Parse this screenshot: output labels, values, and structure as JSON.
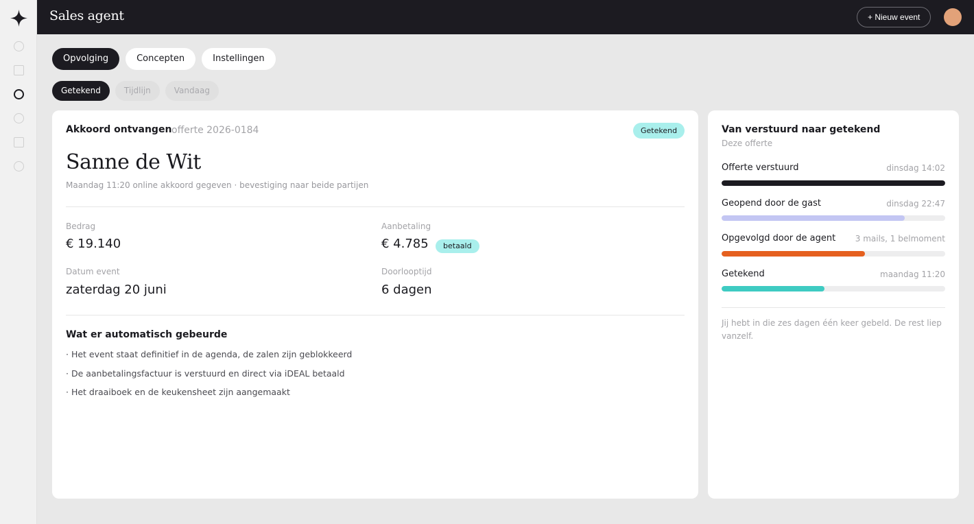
{
  "app": {
    "title": "Sales agent"
  },
  "header": {
    "new_event_label": "+ Nieuw event"
  },
  "tabs": [
    {
      "label": "Opvolging",
      "active": true
    },
    {
      "label": "Concepten",
      "active": false
    },
    {
      "label": "Instellingen",
      "active": false
    }
  ],
  "subtabs": [
    {
      "label": "Getekend",
      "active": true
    },
    {
      "label": "Tijdlijn",
      "active": false
    },
    {
      "label": "Vandaag",
      "active": false
    }
  ],
  "main": {
    "heading": "Akkoord ontvangen",
    "reference": "offerte 2026-0184",
    "status_badge": "Getekend",
    "client_name": "Sanne de Wit",
    "client_subtitle": "Maandag 11:20 online akkoord gegeven · bevestiging naar beide partijen",
    "fields": {
      "amount_label": "Bedrag",
      "amount_value": "€ 19.140",
      "deposit_label": "Aanbetaling",
      "deposit_value": "€ 4.785",
      "deposit_badge": "betaald",
      "date_label": "Datum event",
      "date_value": "zaterdag 20 juni",
      "duration_label": "Doorlooptijd",
      "duration_value": "6 dagen"
    },
    "automation": {
      "heading": "Wat er automatisch gebeurde",
      "items": [
        "· Het event staat definitief in de agenda, de zalen zijn geblokkeerd",
        "· De aanbetalingsfactuur is verstuurd en direct via iDEAL betaald",
        "· Het draaiboek en de keukensheet zijn aangemaakt"
      ]
    }
  },
  "side": {
    "title": "Van verstuurd naar getekend",
    "subtitle": "Deze offerte",
    "steps": [
      {
        "label": "Offerte verstuurd",
        "meta": "dinsdag 14:02",
        "progress": 1.0,
        "color": "#1c1b21"
      },
      {
        "label": "Geopend door de gast",
        "meta": "dinsdag 22:47",
        "progress": 0.82,
        "color": "#c3c6f3"
      },
      {
        "label": "Opgevolgd door de agent",
        "meta": "3 mails, 1 belmoment",
        "progress": 0.64,
        "color": "#e5601f"
      },
      {
        "label": "Getekend",
        "meta": "maandag 11:20",
        "progress": 0.46,
        "color": "#3ecbc2"
      }
    ],
    "note": "Jij hebt in die zes dagen één keer gebeld. De rest liep vanzelf."
  },
  "colors": {
    "dark": "#1c1b21",
    "accent_teal": "#a9efec",
    "avatar": "#e2a279"
  }
}
